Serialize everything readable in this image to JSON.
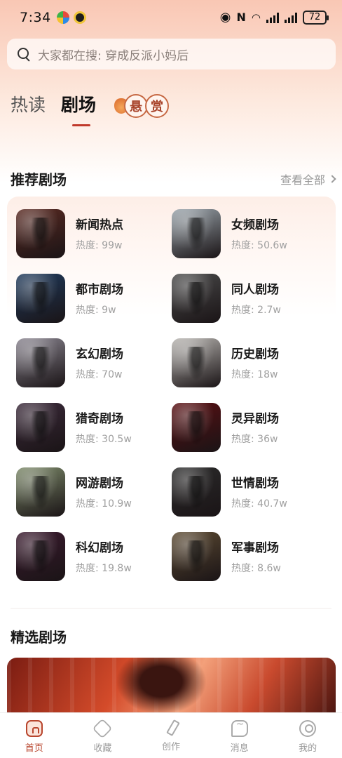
{
  "status_bar": {
    "time": "7:34",
    "battery": "72",
    "icons": [
      "eye-icon",
      "nfc-icon",
      "wifi-icon",
      "signal-icon",
      "signal-icon",
      "battery-icon"
    ]
  },
  "search": {
    "placeholder": "大家都在搜: 穿成反派小妈后"
  },
  "main_tabs": [
    {
      "label": "热读",
      "active": false
    },
    {
      "label": "剧场",
      "active": true
    },
    {
      "label_chars": [
        "悬",
        "赏"
      ],
      "active": false
    }
  ],
  "recommended": {
    "title": "推荐剧场",
    "view_all": "查看全部",
    "items": [
      {
        "name": "新闻热点",
        "heat": "热度: 99w",
        "thumb_color": "#5a2a22"
      },
      {
        "name": "女频剧场",
        "heat": "热度: 50.6w",
        "thumb_color": "#9aa4ab"
      },
      {
        "name": "都市剧场",
        "heat": "热度: 9w",
        "thumb_color": "#1f3a5c"
      },
      {
        "name": "同人剧场",
        "heat": "热度: 2.7w",
        "thumb_color": "#4a4a4a"
      },
      {
        "name": "玄幻剧场",
        "heat": "热度: 70w",
        "thumb_color": "#8a8590"
      },
      {
        "name": "历史剧场",
        "heat": "热度: 18w",
        "thumb_color": "#b9b6b2"
      },
      {
        "name": "猎奇剧场",
        "heat": "热度: 30.5w",
        "thumb_color": "#3b2a3a"
      },
      {
        "name": "灵异剧场",
        "heat": "热度: 36w",
        "thumb_color": "#5a0f12"
      },
      {
        "name": "网游剧场",
        "heat": "热度: 10.9w",
        "thumb_color": "#7d8a6a"
      },
      {
        "name": "世情剧场",
        "heat": "热度: 40.7w",
        "thumb_color": "#2b2b2b"
      },
      {
        "name": "科幻剧场",
        "heat": "热度: 19.8w",
        "thumb_color": "#3a1a2e"
      },
      {
        "name": "军事剧场",
        "heat": "热度: 8.6w",
        "thumb_color": "#5c4a32"
      }
    ]
  },
  "featured": {
    "title": "精选剧场"
  },
  "bottom_nav": [
    {
      "label": "首页",
      "icon": "home-icon",
      "active": true
    },
    {
      "label": "收藏",
      "icon": "collect-icon",
      "active": false
    },
    {
      "label": "创作",
      "icon": "create-icon",
      "active": false
    },
    {
      "label": "消息",
      "icon": "message-icon",
      "active": false
    },
    {
      "label": "我的",
      "icon": "mine-icon",
      "active": false
    }
  ],
  "colors": {
    "accent": "#b8452d",
    "tab_indicator": "#c0392b",
    "header_gradient_top": "#f9c7b4"
  }
}
